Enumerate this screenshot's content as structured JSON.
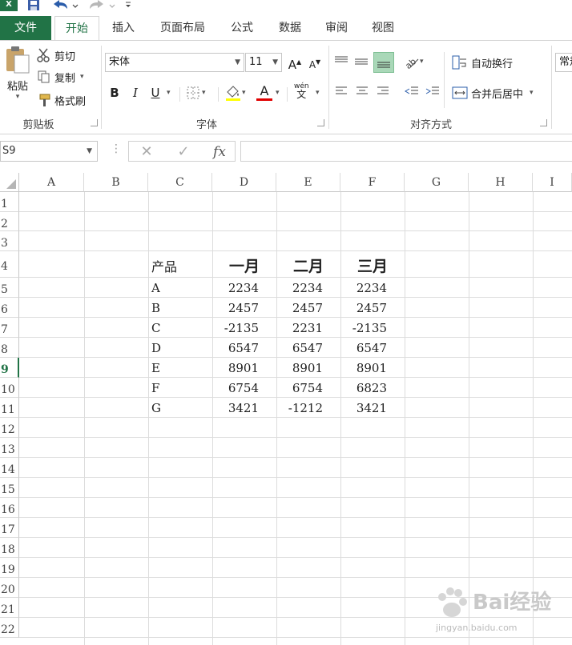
{
  "qat": {
    "logo": "X"
  },
  "tabs": [
    "文件",
    "开始",
    "插入",
    "页面布局",
    "公式",
    "数据",
    "审阅",
    "视图"
  ],
  "clipboard": {
    "paste": "粘贴",
    "cut": "剪切",
    "copy": "复制",
    "painter": "格式刷",
    "label": "剪贴板"
  },
  "font": {
    "name": "宋体",
    "size": "11",
    "label": "字体",
    "bold": "B",
    "italic": "I",
    "underline": "U",
    "font_color": "A",
    "phonetic": "wén"
  },
  "alignment": {
    "wrap": "自动换行",
    "merge": "合并后居中",
    "label": "对齐方式"
  },
  "number": {
    "format": "常规"
  },
  "formula_bar": {
    "name_box": "S9",
    "fx": "fx",
    "value": ""
  },
  "columns": [
    "A",
    "B",
    "C",
    "D",
    "E",
    "F",
    "G",
    "H",
    "I"
  ],
  "rows": [
    "1",
    "2",
    "3",
    "4",
    "5",
    "6",
    "7",
    "8",
    "9",
    "10",
    "11",
    "12",
    "13",
    "14",
    "15",
    "16",
    "17",
    "18",
    "19",
    "20",
    "21",
    "22"
  ],
  "active_row": "9",
  "table": {
    "headers": [
      "产品",
      "一月",
      "二月",
      "三月"
    ],
    "rows": [
      [
        "A",
        "2234",
        "2234",
        "2234"
      ],
      [
        "B",
        "2457",
        "2457",
        "2457"
      ],
      [
        "C",
        "-2135",
        "2231",
        "-2135"
      ],
      [
        "D",
        "6547",
        "6547",
        "6547"
      ],
      [
        "E",
        "8901",
        "8901",
        "8901"
      ],
      [
        "F",
        "6754",
        "6754",
        "6823"
      ],
      [
        "G",
        "3421",
        "-1212",
        "3421"
      ]
    ]
  },
  "watermark": {
    "text": "Bai经验",
    "url": "jingyan.baidu.com"
  },
  "colors": {
    "accent": "#217346",
    "active_align": "#a9d8b8"
  }
}
